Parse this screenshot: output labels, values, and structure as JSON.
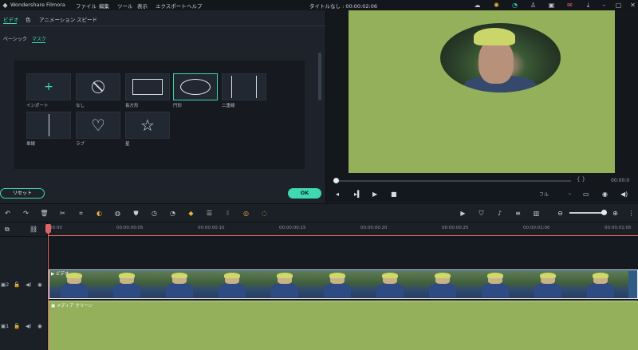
{
  "app": {
    "title": "Wondershare Filmora"
  },
  "menu": [
    "ファイル",
    "編集",
    "ツール",
    "表示",
    "エクスポート",
    "ヘルプ"
  ],
  "project": {
    "title": "タイトルなし : 00:00:02:06"
  },
  "top_tabs": [
    "ビデオ",
    "色",
    "アニメーション",
    "スピード"
  ],
  "sub_tabs": [
    "ベーシック",
    "マスク"
  ],
  "masks": [
    {
      "label": "インポート",
      "icon": "plus-icon"
    },
    {
      "label": "なし",
      "icon": "none-icon"
    },
    {
      "label": "長方形",
      "icon": "rectangle-icon"
    },
    {
      "label": "円形",
      "icon": "ellipse-icon"
    },
    {
      "label": "二重線",
      "icon": "double-line-icon"
    },
    {
      "label": "単線",
      "icon": "single-line-icon"
    },
    {
      "label": "ラブ",
      "icon": "heart-icon"
    },
    {
      "label": "星",
      "icon": "star-icon"
    }
  ],
  "selected_mask": "円形",
  "buttons": {
    "reset": "リセット",
    "ok": "OK"
  },
  "preview": {
    "time_display": "00:00:0",
    "quality": "フル",
    "brackets": "{    }"
  },
  "timeline": {
    "ticks": [
      "00:00",
      "00:00:00:05",
      "00:00:00:10",
      "00:00:00:15",
      "00:00:00:20",
      "00:00:00:25",
      "00:00:01:00",
      "00:00:01:05"
    ],
    "video_clip_label": "ビデオ",
    "color_clip_label": "メディア クリーン",
    "tracks": [
      {
        "number": "2"
      },
      {
        "number": "1"
      }
    ]
  },
  "colors": {
    "accent": "#3fd8b0",
    "playhead": "#e06464",
    "green_screen": "#94b05a"
  }
}
